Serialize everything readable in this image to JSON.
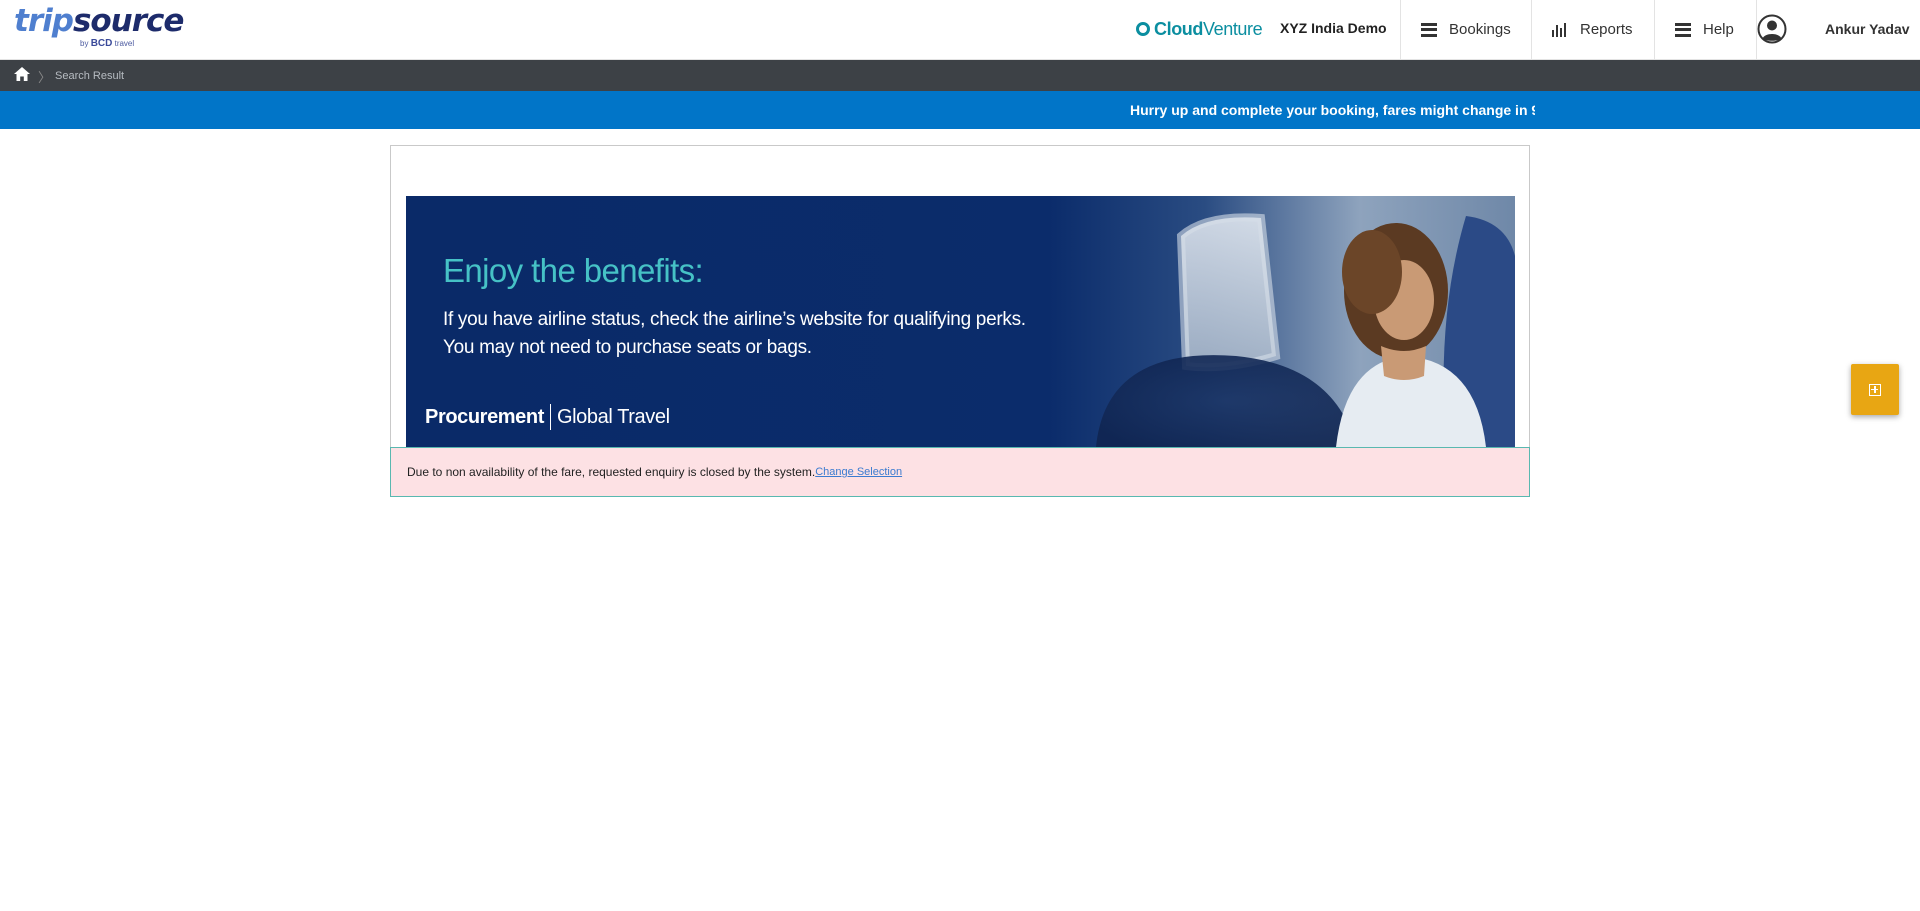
{
  "header": {
    "logo": {
      "trip": "trip",
      "source": "source",
      "by": "by",
      "bcd": "BCD",
      "travel": "travel"
    },
    "cloudventure": {
      "cloud": "Cloud",
      "venture": "Venture"
    },
    "company": "XYZ India Demo",
    "nav": {
      "bookings": "Bookings",
      "reports": "Reports",
      "help": "Help"
    },
    "user_name": "Ankur Yadav"
  },
  "breadcrumb": {
    "current": "Search Result"
  },
  "announcement": {
    "text": "Hurry up and complete your booking, fares might change in 9"
  },
  "banner": {
    "headline": "Enjoy the benefits:",
    "line1": "If you have airline status, check the airline’s website for qualifying perks.",
    "line2": "You may not need to purchase seats or bags.",
    "footer_left": "Procurement",
    "footer_right": "Global Travel"
  },
  "alert": {
    "message": "Due to non availability of the fare, requested enquiry is closed by the system.",
    "link": "Change Selection"
  },
  "colors": {
    "brand_blue": "#0175c8",
    "crumb_bar": "#3d4146",
    "alert_bg": "#fde1e4",
    "alert_border": "#59b8b0",
    "side_button": "#e8a613",
    "cloudventure_teal": "#0b8ea0"
  },
  "icons": {
    "home": "home-icon",
    "bookings": "hamburger-icon",
    "reports": "bar-chart-icon",
    "help": "hamburger-icon",
    "user": "user-avatar-icon",
    "side_button": "add-box-icon"
  }
}
